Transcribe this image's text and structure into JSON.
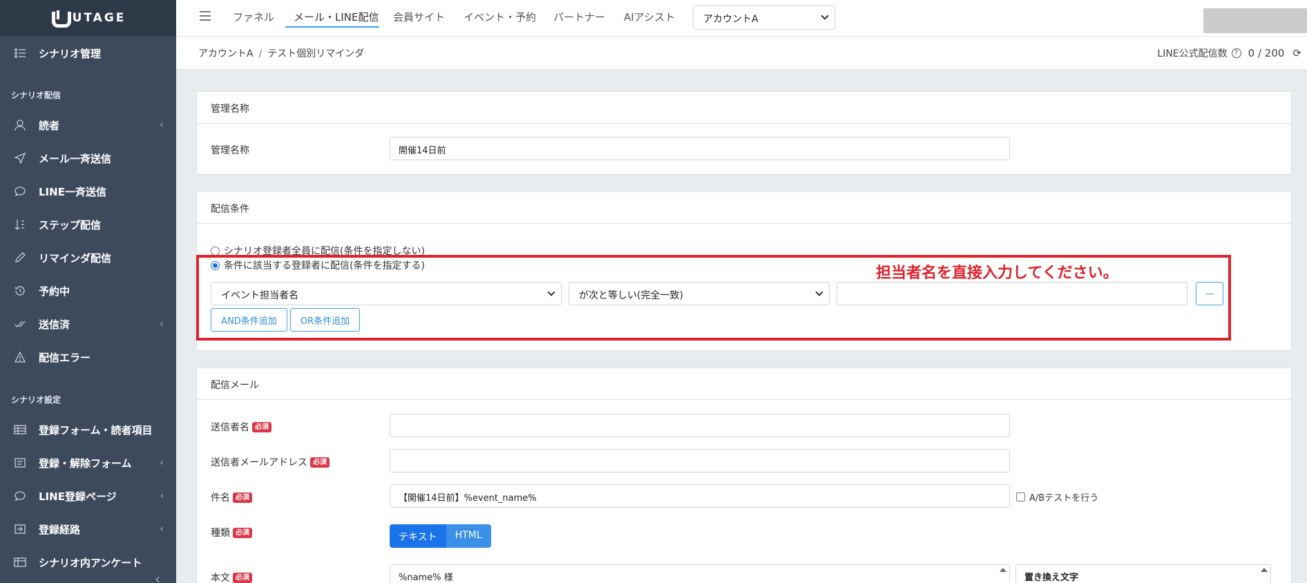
{
  "brand": {
    "name": "UTAGE"
  },
  "sidebar": {
    "top_item": "シナリオ管理",
    "heading_delivery": "シナリオ配信",
    "heading_settings": "シナリオ設定",
    "items": [
      {
        "label": "読者",
        "icon": "reader-icon"
      },
      {
        "label": "メール一斉送信",
        "icon": "send-icon"
      },
      {
        "label": "LINE一斉送信",
        "icon": "chat-icon"
      },
      {
        "label": "ステップ配信",
        "icon": "step-icon"
      },
      {
        "label": "リマインダ配信",
        "icon": "pencil-icon"
      },
      {
        "label": "予約中",
        "icon": "history-icon"
      },
      {
        "label": "送信済",
        "icon": "check-icon"
      },
      {
        "label": "配信エラー",
        "icon": "warning-icon"
      },
      {
        "label": "登録フォーム・読者項目",
        "icon": "table-icon"
      },
      {
        "label": "登録・解除フォーム",
        "icon": "form-icon"
      },
      {
        "label": "LINE登録ページ",
        "icon": "chat-icon"
      },
      {
        "label": "登録経路",
        "icon": "route-icon"
      },
      {
        "label": "シナリオ内アンケート",
        "icon": "table-icon"
      }
    ]
  },
  "topnav": {
    "links": [
      "ファネル",
      "メール・LINE配信",
      "会員サイト",
      "イベント・予約",
      "パートナー",
      "AIアシスト"
    ],
    "account": "アカウントA"
  },
  "breadcrumb": {
    "account": "アカウントA",
    "page": "テスト個別リマインダ"
  },
  "line_count": {
    "label": "LINE公式配信数",
    "value": "0 / 200"
  },
  "mgmt": {
    "header": "管理名称",
    "label": "管理名称",
    "value": "開催14日前"
  },
  "conditions": {
    "header": "配信条件",
    "option_all": "シナリオ登録者全員に配信(条件を指定しない)",
    "option_cond": "条件に該当する登録者に配信(条件を指定する)",
    "field": "イベント担当者名",
    "operator": "が次と等しい(完全一致)",
    "value": "",
    "remove": "—",
    "add_and": "AND条件追加",
    "add_or": "OR条件追加",
    "annotation": "担当者名を直接入力してください。"
  },
  "mail": {
    "header": "配信メール",
    "required": "必須",
    "sender_name_label": "送信者名",
    "sender_email_label": "送信者メールアドレス",
    "subject_label": "件名",
    "subject_value": "【開催14日前】%event_name%",
    "ab_test": "A/Bテストを行う",
    "type_label": "種類",
    "type_text": "テキスト",
    "type_html": "HTML",
    "body_label": "本文",
    "body_value": "%name% 様",
    "replace_label": "置き換え文字"
  }
}
